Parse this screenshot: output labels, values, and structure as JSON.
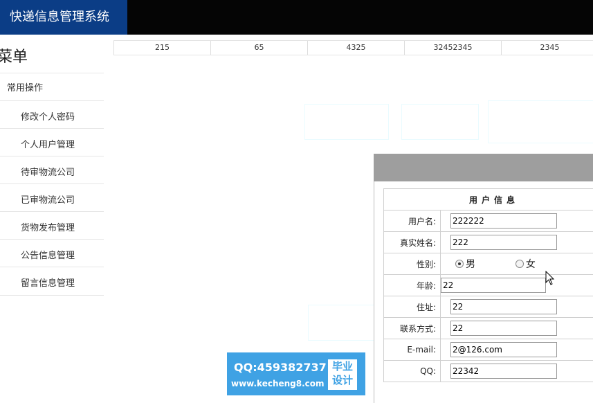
{
  "app": {
    "title": "快递信息管理系统"
  },
  "sidebar": {
    "title": "菜单",
    "group": "常用操作",
    "items": [
      {
        "label": "修改个人密码"
      },
      {
        "label": "个人用户管理"
      },
      {
        "label": "待审物流公司"
      },
      {
        "label": "已审物流公司"
      },
      {
        "label": "货物发布管理"
      },
      {
        "label": "公告信息管理"
      },
      {
        "label": "留言信息管理"
      }
    ]
  },
  "strip": {
    "cells": [
      "215",
      "65",
      "4325",
      "32452345",
      "2345"
    ]
  },
  "dialog": {
    "title": "用户信息",
    "fields": {
      "username": {
        "label": "用户名:",
        "value": "222222"
      },
      "realname": {
        "label": "真实姓名:",
        "value": "222"
      },
      "gender": {
        "label": "性别:",
        "option_male": "男",
        "option_female": "女",
        "selected": "男"
      },
      "age": {
        "label": "年龄:",
        "value": "22"
      },
      "address": {
        "label": "住址:",
        "value": "22"
      },
      "contact": {
        "label": "联系方式:",
        "value": "22"
      },
      "email": {
        "label": "E-mail:",
        "value": "2@126.com"
      },
      "qq": {
        "label": "QQ:",
        "value": "22342"
      }
    }
  },
  "watermark": {
    "qq": "QQ:459382737",
    "url": "www.kecheng8.com",
    "box_line1": "毕业",
    "box_line2": "设计"
  },
  "colors": {
    "brand": "#0b3d86",
    "topbar": "#050505",
    "dialog_header": "#9e9e9e",
    "watermark": "#3fa2e4"
  }
}
